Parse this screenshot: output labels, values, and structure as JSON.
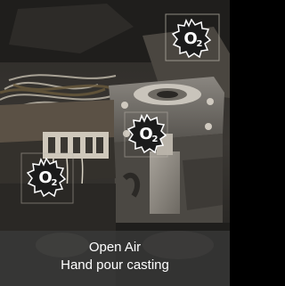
{
  "badges": {
    "symbol": "O",
    "subscript": "2",
    "color": "#1b1b1b"
  },
  "caption": {
    "line1": "Open Air",
    "line2": "Hand pour casting"
  }
}
